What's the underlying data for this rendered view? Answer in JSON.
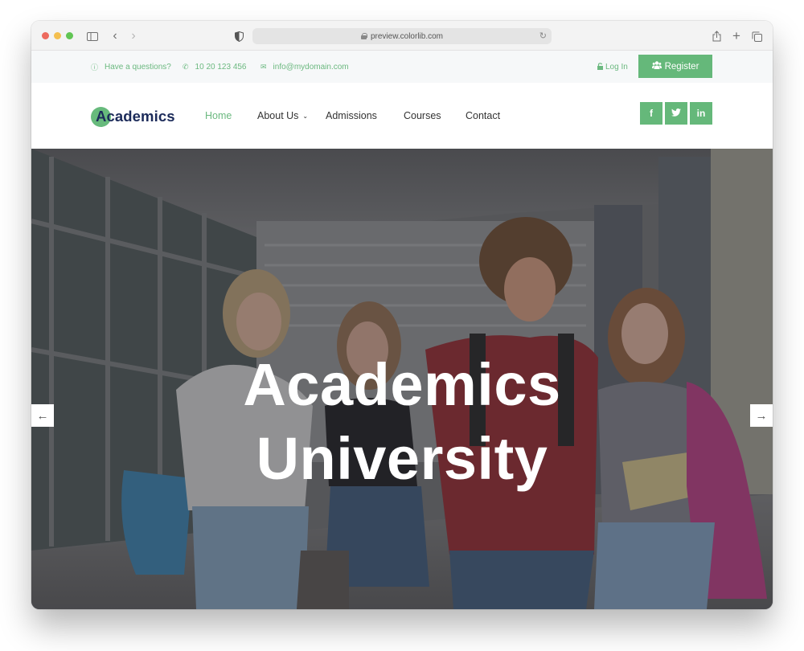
{
  "browser": {
    "url": "preview.colorlib.com",
    "icons": {
      "sidebar": "sidebar-icon",
      "back": "chevron-left-icon",
      "forward": "chevron-right-icon",
      "shield": "shield-icon",
      "lock": "lock-icon",
      "reload": "reload-icon",
      "share": "share-icon",
      "new_tab": "plus-icon",
      "tabs": "tabs-overview-icon"
    }
  },
  "topbar": {
    "question": "Have a questions?",
    "phone": "10 20 123 456",
    "email": "info@mydomain.com",
    "login": "Log In",
    "register": "Register",
    "accent_color": "#65b87a"
  },
  "navbar": {
    "logo": "Academics",
    "items": [
      {
        "label": "Home",
        "active": true
      },
      {
        "label": "About Us",
        "has_dropdown": true
      },
      {
        "label": "Admissions"
      },
      {
        "label": "Courses"
      },
      {
        "label": "Contact"
      }
    ],
    "social": [
      {
        "name": "facebook",
        "glyph": "f"
      },
      {
        "name": "twitter",
        "glyph": "t"
      },
      {
        "name": "linkedin",
        "glyph": "in"
      }
    ]
  },
  "hero": {
    "title_line1": "Academics",
    "title_line2": "University",
    "prev_arrow": "←",
    "next_arrow": "→"
  }
}
